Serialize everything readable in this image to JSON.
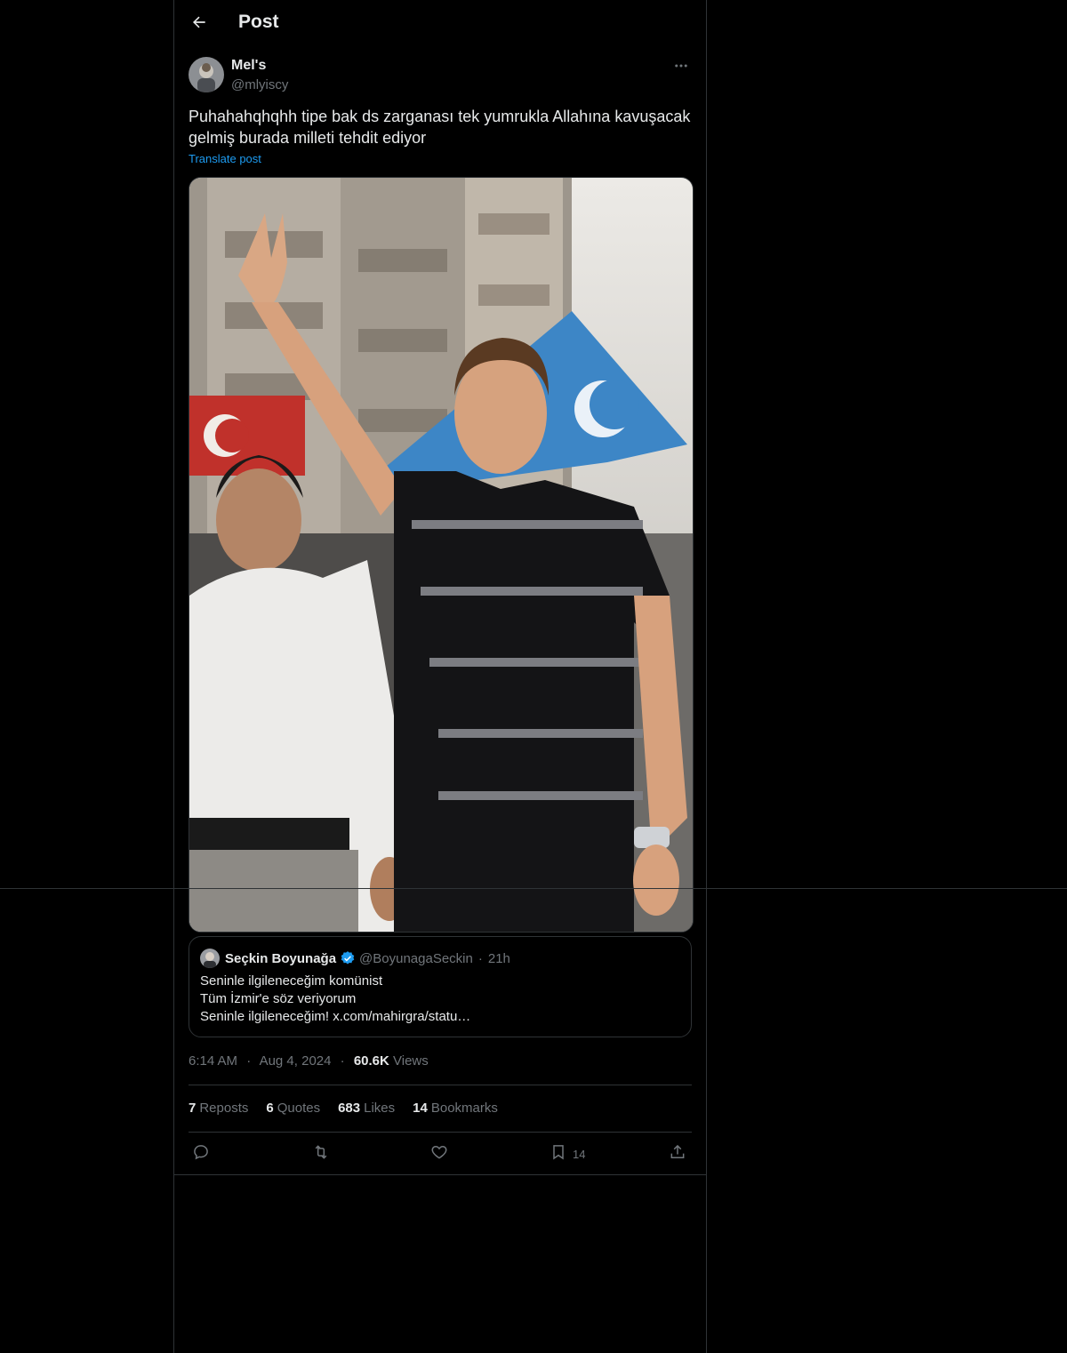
{
  "header": {
    "title": "Post"
  },
  "post": {
    "author_name": "Mel's",
    "author_handle": "@mlyiscy",
    "text": "Puhahahqhqhh tipe bak ds zarganası tek yumrukla Allahına kavuşacak\ngelmiş burada milleti tehdit ediyor",
    "translate_label": "Translate post"
  },
  "quote": {
    "name": "Seçkin Boyunağa",
    "handle": "@BoyunagaSeckin",
    "separator": "·",
    "time": "21h",
    "lines": [
      "Seninle ilgileneceğim komünist",
      "Tüm İzmir'e söz veriyorum",
      "Seninle ilgileneceğim! x.com/mahirgra/statu…"
    ]
  },
  "meta": {
    "time": "6:14 AM",
    "separator": "·",
    "date": "Aug 4, 2024",
    "views_count": "60.6K",
    "views_label": "Views"
  },
  "stats": {
    "reposts": {
      "count": "7",
      "label": "Reposts"
    },
    "quotes": {
      "count": "6",
      "label": "Quotes"
    },
    "likes": {
      "count": "683",
      "label": "Likes"
    },
    "bookmarks": {
      "count": "14",
      "label": "Bookmarks"
    }
  },
  "actions": {
    "bookmark_count": "14"
  },
  "colors": {
    "background": "#000000",
    "text": "#e7e9ea",
    "muted": "#71767b",
    "link": "#1d9bf0",
    "border": "#2f3336"
  }
}
